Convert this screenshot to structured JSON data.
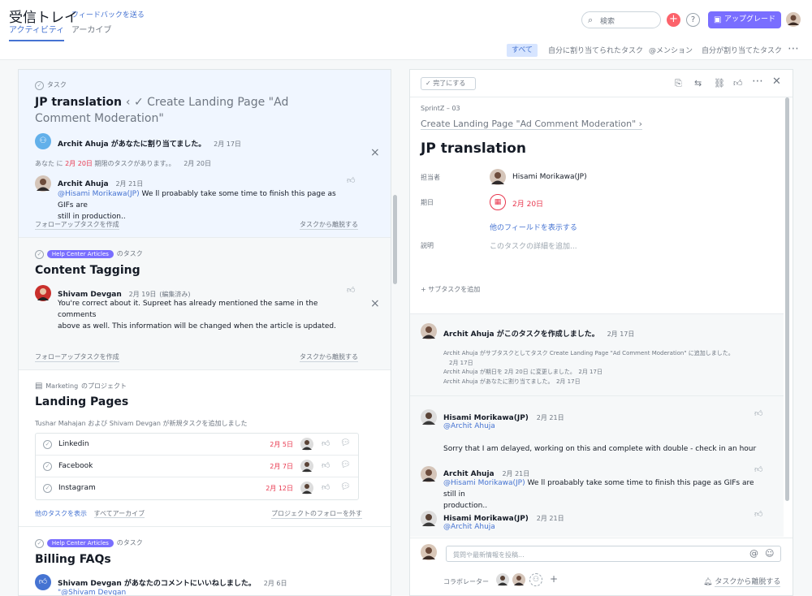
{
  "header": {
    "title": "受信トレイ",
    "feedback_link": "フィードバックを送る",
    "tabs": [
      "アクティビティ",
      "アーカイブ"
    ],
    "search_placeholder": "検索",
    "upgrade_label": "アップグレード",
    "help_label": "?",
    "plus_label": "+"
  },
  "filters": [
    "すべて",
    "自分に割り当てられたタスク",
    "@メンション",
    "自分が割り当てたタスク"
  ],
  "cards": [
    {
      "type_label": "タスク",
      "title": "JP translation",
      "parent": "‹ ✓ Create Landing Page \"Ad Comment Moderation\"",
      "assign_text": "Archit Ahuja があなたに割り当てました。",
      "assign_date": "2月 17日",
      "due_prefix": "あなた に",
      "due_date": "2月 20日",
      "due_suffix": "期限のタスクがあります。。",
      "due_posted": "2月 20日",
      "comment_author": "Archit Ahuja",
      "comment_date": "2月 21日",
      "comment_mention": "@Hisami Morikawa(JP)",
      "comment_text": "We ll proabably take some time to finish this page as GIFs are",
      "comment_text2": "still in production..",
      "follow_up": "フォローアップタスクを作成",
      "leave": "タスクから離脱する"
    },
    {
      "project_tag": "Help Center Articles",
      "type_label": "のタスク",
      "title": "Content Tagging",
      "comment_author": "Shivam Devgan",
      "comment_date": "2月 19日",
      "comment_edited": "(編集済み)",
      "comment_text": "You're correct about it. Supreet has already mentioned the same in the comments",
      "comment_text2": "above as well. This information will be changed when the article is updated.",
      "follow_up": "フォローアップタスクを作成",
      "leave": "タスクから離脱する"
    },
    {
      "project_prefix": "Marketing",
      "type_label": "のプロジェクト",
      "title": "Landing Pages",
      "subtitle": "Tushar Mahajan および Shivam Devgan が新規タスクを追加しました",
      "tasks": [
        {
          "name": "Linkedin",
          "date": "2月 5日"
        },
        {
          "name": "Facebook",
          "date": "2月 7日"
        },
        {
          "name": "Instagram",
          "date": "2月 12日"
        }
      ],
      "show_more": "他のタスクを表示",
      "archive_all": "すべてアーカイブ",
      "unfollow": "プロジェクトのフォローを外す"
    },
    {
      "project_tag": "Help Center Articles",
      "type_label": "のタスク",
      "title": "Billing FAQs",
      "like_text": "Shivam Devgan があなたのコメントにいいねしました。",
      "like_date": "2月 6日",
      "like_mention": "\"@Shivam Devgan"
    }
  ],
  "detail": {
    "complete_label": "✓ 完了にする",
    "breadcrumb": "SprintZ – 03",
    "parent_link": "Create Landing Page \"Ad Comment Moderation\" ›",
    "title": "JP translation",
    "assignee_label": "担当者",
    "assignee": "Hisami Morikawa(JP)",
    "due_label": "期日",
    "due": "2月 20日",
    "more_fields": "他のフィールドを表示する",
    "desc_label": "説明",
    "desc_placeholder": "このタスクの詳細を追加...",
    "add_subtask": "+ サブタスクを追加",
    "created_by": "Archit Ahuja がこのタスクを作成しました。",
    "created_date": "2月 17日",
    "log": [
      "Archit Ahuja がサブタスクとしてタスク Create Landing Page \"Ad Comment Moderation\" に追加しました。",
      "2月 17日",
      "Archit Ahuja が期日を 2月 20日 に変更しました。　2月 17日",
      "Archit Ahuja があなたに割り当てました。　2月 17日"
    ],
    "comments": [
      {
        "author": "Hisami Morikawa(JP)",
        "date": "2月 21日",
        "mention": "@Archit Ahuja",
        "text": "Sorry that I am delayed, working on this and complete with double - check in an hour"
      },
      {
        "author": "Archit Ahuja",
        "date": "2月 21日",
        "mention": "@Hisami Morikawa(JP)",
        "text": "We ll proabably take some time to finish this page as GIFs are still in",
        "text2": "production.."
      },
      {
        "author": "Hisami Morikawa(JP)",
        "date": "2月 21日",
        "mention": "@Archit Ahuja"
      }
    ],
    "comment_placeholder": "質問や最新情報を投稿...",
    "collaborators_label": "コラボレーター",
    "leave_task": "タスクから離脱する"
  },
  "colors": {
    "accent": "#4573d2",
    "upgrade": "#796eff",
    "danger": "#e8384f",
    "plus": "#fc636b"
  }
}
